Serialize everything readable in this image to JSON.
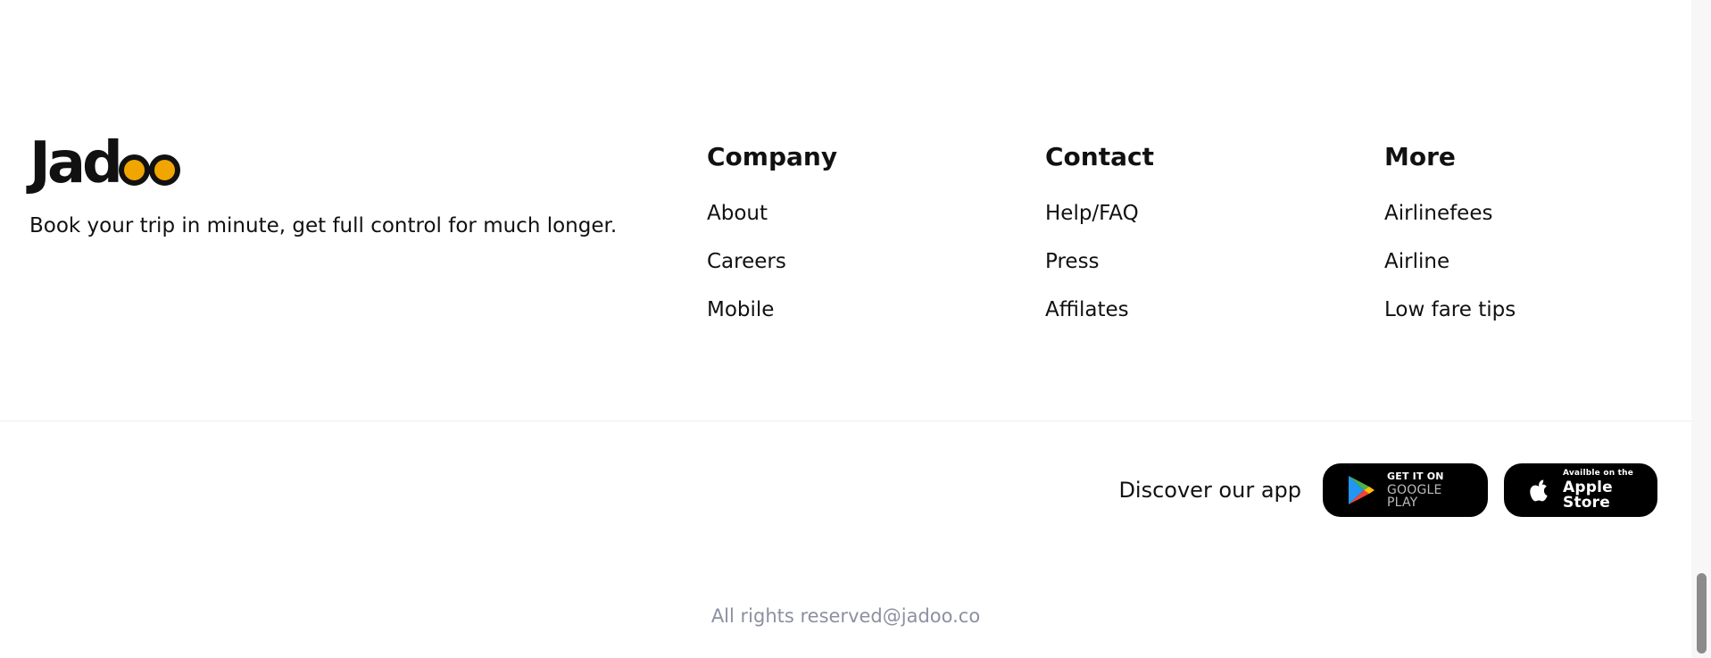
{
  "brand": {
    "logo_prefix": "Jad",
    "tagline": "Book your trip in minute, get full control for much longer."
  },
  "columns": [
    {
      "heading": "Company",
      "links": [
        "About",
        "Careers",
        "Mobile"
      ]
    },
    {
      "heading": "Contact",
      "links": [
        "Help/FAQ",
        "Press",
        "Affilates"
      ]
    },
    {
      "heading": "More",
      "links": [
        "Airlinefees",
        "Airline",
        "Low fare tips"
      ]
    }
  ],
  "app": {
    "discover_label": "Discover our app",
    "google_top": "GET IT ON",
    "google_bottom": "GOOGLE PLAY",
    "apple_top": "Availble on the",
    "apple_bottom": "Apple Store"
  },
  "copyright": "All rights reserved@jadoo.co",
  "colors": {
    "accent": "#F1A501",
    "muted_text": "#8C90A0",
    "button_bg": "#000000"
  },
  "icons": {
    "google_play": "google-play-icon",
    "apple": "apple-icon"
  }
}
